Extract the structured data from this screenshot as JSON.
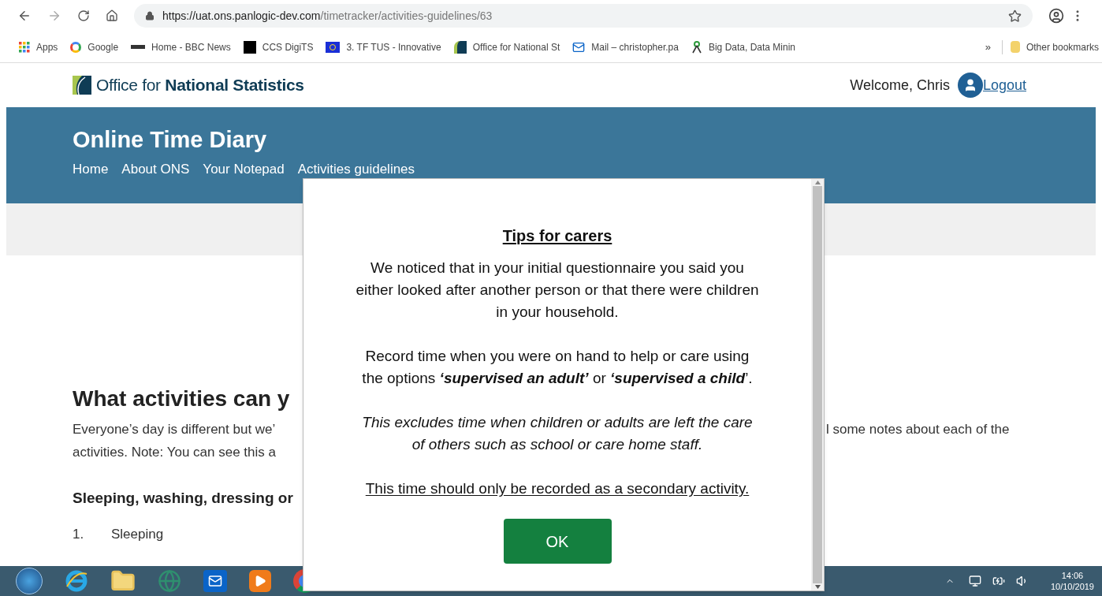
{
  "browser": {
    "url_host": "https://uat.ons.panlogic-dev.com",
    "url_path": "/timetracker/activities-guidelines/63",
    "bookmarks": [
      {
        "label": "Apps",
        "kind": "apps"
      },
      {
        "label": "Google",
        "kind": "google"
      },
      {
        "label": "Home - BBC News",
        "kind": "bbc"
      },
      {
        "label": "CCS DigiTS",
        "kind": "ccs"
      },
      {
        "label": "3. TF TUS - Innovative",
        "kind": "eu"
      },
      {
        "label": "Office for National St",
        "kind": "ons"
      },
      {
        "label": "Mail – christopher.pa",
        "kind": "mail"
      },
      {
        "label": "Big Data, Data Minin",
        "kind": "data"
      }
    ],
    "overflow": "»",
    "other_bookmarks": "Other bookmarks"
  },
  "header": {
    "logo_text": "Office for **National Statistics**",
    "welcome": "Welcome, Chris",
    "logout": "Logout"
  },
  "banner": {
    "title": "Online Time Diary",
    "nav": [
      "Home",
      "About ONS",
      "Your Notepad",
      "Activities guidelines"
    ]
  },
  "content": {
    "heading": "What activities can y",
    "para_left": [
      "Everyone’s day is different but we’",
      "activities. Note: You can see this a"
    ],
    "para_right": "l some notes about each of the",
    "subheading": "Sleeping, washing, dressing or",
    "list": [
      {
        "number": "1.",
        "text": "Sleeping"
      }
    ]
  },
  "modal": {
    "title": "Tips for carers",
    "paragraphs": [
      {
        "kind": "plain",
        "text": "We noticed that in your initial questionnaire you said you either looked after another person or that there were children in your household."
      },
      {
        "kind": "plain",
        "text": "Record time when you were on hand to help or care using the options **‘supervised an adult’** or **‘supervised a child**’."
      },
      {
        "kind": "italic",
        "text": "This excludes time when children or adults are left the care of others such as school or care home staff."
      },
      {
        "kind": "underlined",
        "text": "This time should only be recorded as a secondary activity."
      }
    ],
    "button": "OK"
  },
  "taskbar": {
    "time": "14:06",
    "date": "10/10/2019"
  }
}
